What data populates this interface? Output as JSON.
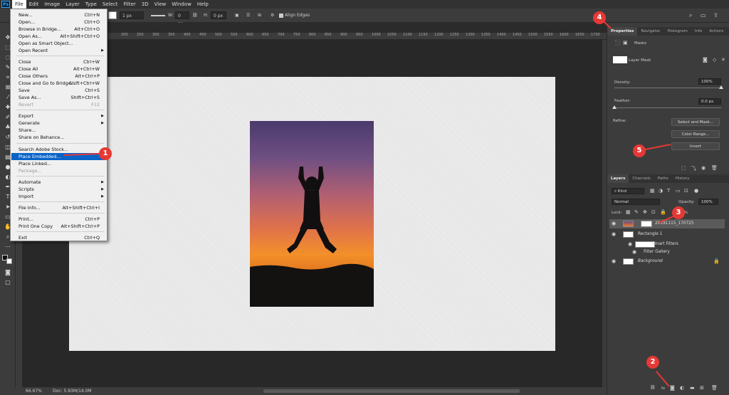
{
  "menubar": {
    "logo": "Ps",
    "items": [
      "File",
      "Edit",
      "Image",
      "Layer",
      "Type",
      "Select",
      "Filter",
      "3D",
      "View",
      "Window",
      "Help"
    ]
  },
  "options": {
    "stroke_size": "1 px",
    "w_label": "W:",
    "w_value": "0 px",
    "h_label": "H:",
    "h_value": "0 px",
    "align_edges": "Align Edges"
  },
  "ruler_ticks": [
    "200",
    "250",
    "300",
    "350",
    "400",
    "450",
    "500",
    "550",
    "600",
    "650",
    "700",
    "750",
    "800",
    "850",
    "900",
    "950",
    "1000",
    "1050",
    "1100",
    "1150",
    "1200",
    "1250",
    "1300",
    "1350",
    "1400",
    "1450",
    "1500",
    "1550",
    "1600",
    "1650",
    "1700"
  ],
  "file_menu": {
    "items": [
      {
        "label": "New...",
        "shortcut": "Ctrl+N"
      },
      {
        "label": "Open...",
        "shortcut": "Ctrl+O"
      },
      {
        "label": "Browse in Bridge...",
        "shortcut": "Alt+Ctrl+O"
      },
      {
        "label": "Open As...",
        "shortcut": "Alt+Shift+Ctrl+O"
      },
      {
        "label": "Open as Smart Object...",
        "shortcut": ""
      },
      {
        "label": "Open Recent",
        "shortcut": ""
      },
      {
        "label": "Close",
        "shortcut": "Ctrl+W"
      },
      {
        "label": "Close All",
        "shortcut": "Alt+Ctrl+W"
      },
      {
        "label": "Close Others",
        "shortcut": "Alt+Ctrl+P"
      },
      {
        "label": "Close and Go to Bridge...",
        "shortcut": "Shift+Ctrl+W"
      },
      {
        "label": "Save",
        "shortcut": "Ctrl+S"
      },
      {
        "label": "Save As...",
        "shortcut": "Shift+Ctrl+S"
      },
      {
        "label": "Revert",
        "shortcut": "F12"
      },
      {
        "label": "Export",
        "shortcut": ""
      },
      {
        "label": "Generate",
        "shortcut": ""
      },
      {
        "label": "Share...",
        "shortcut": ""
      },
      {
        "label": "Share on Behance...",
        "shortcut": ""
      },
      {
        "label": "Search Adobe Stock...",
        "shortcut": ""
      },
      {
        "label": "Place Embedded...",
        "shortcut": ""
      },
      {
        "label": "Place Linked...",
        "shortcut": ""
      },
      {
        "label": "Package...",
        "shortcut": ""
      },
      {
        "label": "Automate",
        "shortcut": ""
      },
      {
        "label": "Scripts",
        "shortcut": ""
      },
      {
        "label": "Import",
        "shortcut": ""
      },
      {
        "label": "File Info...",
        "shortcut": "Alt+Shift+Ctrl+I"
      },
      {
        "label": "Print...",
        "shortcut": "Ctrl+P"
      },
      {
        "label": "Print One Copy",
        "shortcut": "Alt+Shift+Ctrl+P"
      },
      {
        "label": "Exit",
        "shortcut": "Ctrl+Q"
      }
    ]
  },
  "properties": {
    "tabs": [
      "Properties",
      "Navigator",
      "Histogram",
      "Info",
      "Actions"
    ],
    "masks_label": "Masks",
    "layer_mask_label": "Layer Mask",
    "density_label": "Density:",
    "density_value": "100%",
    "density_level": 1.0,
    "feather_label": "Feather:",
    "feather_value": "0.0 px",
    "feather_level": 0.0,
    "refine_label": "Refine:",
    "select_mask_button": "Select and Mask...",
    "color_range_button": "Color Range...",
    "invert_button": "Invert"
  },
  "layers": {
    "tabs": [
      "Layers",
      "Channels",
      "Paths",
      "History"
    ],
    "kind_filter": "Kind",
    "blend_mode": "Normal",
    "opacity_label": "Opacity:",
    "opacity_value": "100%",
    "lock_label": "Lock:",
    "fill_value": "%",
    "items": [
      {
        "name": "20191115_170725"
      },
      {
        "name": "Rectangle 1"
      },
      {
        "name": "Smart Filters"
      },
      {
        "name": "Filter Gallery"
      },
      {
        "name": "Background"
      }
    ],
    "footer_fx": "fx"
  },
  "status": {
    "zoom": "66.67%",
    "doc": "Doc: 5.93M/14.0M"
  },
  "callouts": [
    "1",
    "2",
    "3",
    "4",
    "5"
  ],
  "colors": {
    "highlight": "#0a64c8",
    "callout": "#e53935"
  }
}
